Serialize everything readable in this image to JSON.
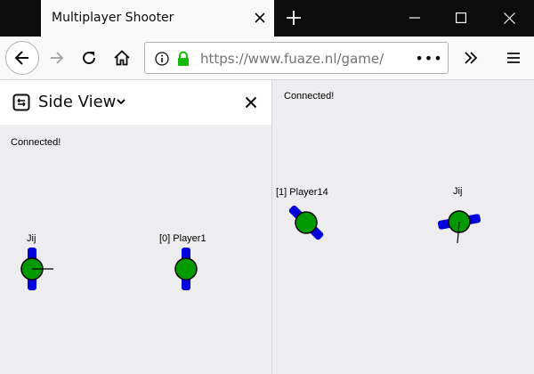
{
  "browser": {
    "tab_title": "Multiplayer Shooter",
    "url_host": "https://www.fuaze.nl",
    "url_path": "/game/",
    "url_more": "•••"
  },
  "sidebar": {
    "title": "Side View",
    "status": "Connected!",
    "players": [
      {
        "label": "Jij"
      },
      {
        "label": "[0] Player1"
      }
    ]
  },
  "main": {
    "status": "Connected!",
    "players": [
      {
        "label": "[1] Player14"
      },
      {
        "label": "Jij"
      }
    ]
  },
  "colors": {
    "player_body": "#009900",
    "player_gun": "#0000dd",
    "titlebar": "#0c0c0d"
  },
  "icons": [
    "close-icon",
    "plus-icon",
    "minimize-icon",
    "maximize-icon",
    "back-icon",
    "forward-icon",
    "reload-icon",
    "home-icon",
    "info-icon",
    "lock-icon",
    "overflow-icon",
    "menu-icon",
    "sidebar-icon",
    "chevron-down-icon"
  ]
}
